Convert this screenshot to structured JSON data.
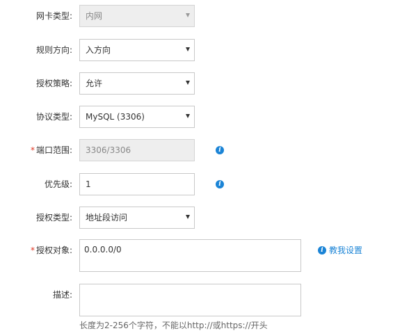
{
  "form": {
    "nic_type": {
      "label": "网卡类型:",
      "value": "内网"
    },
    "direction": {
      "label": "规则方向:",
      "value": "入方向"
    },
    "policy": {
      "label": "授权策略:",
      "value": "允许"
    },
    "protocol": {
      "label": "协议类型:",
      "value": "MySQL (3306)"
    },
    "port_range": {
      "label": "端口范围:",
      "required_mark": "*",
      "value": "3306/3306",
      "info_icon": "info-icon"
    },
    "priority": {
      "label": "优先级:",
      "value": "1",
      "info_icon": "info-icon"
    },
    "auth_type": {
      "label": "授权类型:",
      "value": "地址段访问"
    },
    "auth_object": {
      "label": "授权对象:",
      "required_mark": "*",
      "value": "0.0.0.0/0",
      "help_link": "教我设置"
    },
    "description": {
      "label": "描述:",
      "value": "",
      "hint": "长度为2-256个字符，不能以http://或https://开头"
    }
  },
  "colors": {
    "link": "#1b84d6",
    "required": "#e0331f",
    "disabled_bg": "#eeeeee",
    "border": "#c8c8c8"
  }
}
